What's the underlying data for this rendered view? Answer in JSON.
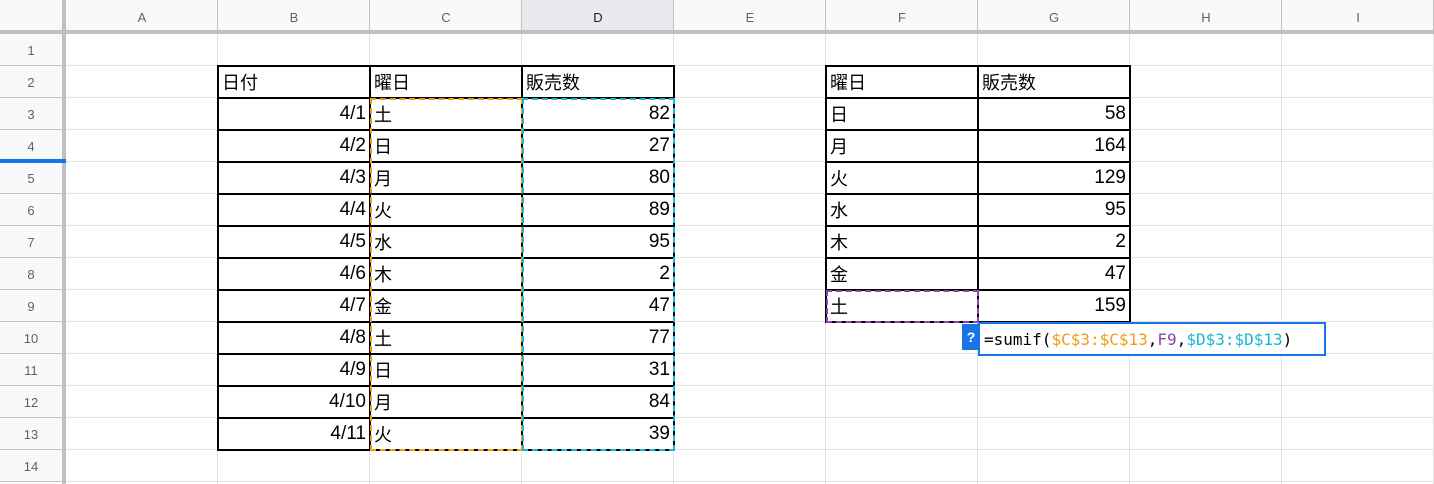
{
  "columns": [
    "A",
    "B",
    "C",
    "D",
    "E",
    "F",
    "G",
    "H",
    "I"
  ],
  "rows": [
    "1",
    "2",
    "3",
    "4",
    "5",
    "6",
    "7",
    "8",
    "9",
    "10",
    "11",
    "12",
    "13",
    "14"
  ],
  "table1": {
    "headers": [
      "日付",
      "曜日",
      "販売数"
    ],
    "rows": [
      [
        "4/1",
        "土",
        "82"
      ],
      [
        "4/2",
        "日",
        "27"
      ],
      [
        "4/3",
        "月",
        "80"
      ],
      [
        "4/4",
        "火",
        "89"
      ],
      [
        "4/5",
        "水",
        "95"
      ],
      [
        "4/6",
        "木",
        "2"
      ],
      [
        "4/7",
        "金",
        "47"
      ],
      [
        "4/8",
        "土",
        "77"
      ],
      [
        "4/9",
        "日",
        "31"
      ],
      [
        "4/10",
        "月",
        "84"
      ],
      [
        "4/11",
        "火",
        "39"
      ]
    ]
  },
  "table2": {
    "headers": [
      "曜日",
      "販売数"
    ],
    "rows": [
      [
        "日",
        "58"
      ],
      [
        "月",
        "164"
      ],
      [
        "火",
        "129"
      ],
      [
        "水",
        "95"
      ],
      [
        "木",
        "2"
      ],
      [
        "金",
        "47"
      ],
      [
        "土",
        "159"
      ]
    ]
  },
  "formula": {
    "help": "?",
    "parts": [
      {
        "text": "=sumif(",
        "color": "#000000"
      },
      {
        "text": "$C$3:$C$13",
        "color": "#f39c12"
      },
      {
        "text": ",",
        "color": "#000000"
      },
      {
        "text": "F9",
        "color": "#8e44ad"
      },
      {
        "text": ",",
        "color": "#000000"
      },
      {
        "text": "$D$3:$D$13",
        "color": "#1ab6d6"
      },
      {
        "text": ")",
        "color": "#000000"
      }
    ]
  },
  "colors": {
    "accent": "#1a73e8",
    "range_orange": "#f39c12",
    "range_teal": "#1ab6d6",
    "range_purple": "#8e44ad"
  }
}
